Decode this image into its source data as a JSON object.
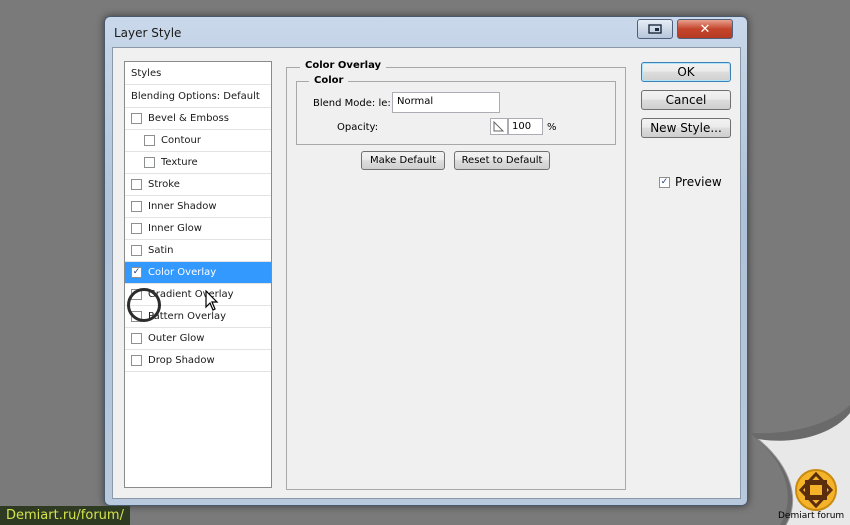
{
  "window": {
    "title": "Layer Style"
  },
  "styles_list": {
    "header": "Styles",
    "blending": "Blending Options: Default",
    "items": [
      {
        "label": "Bevel & Emboss",
        "checked": false,
        "indent": 1
      },
      {
        "label": "Contour",
        "checked": false,
        "indent": 2
      },
      {
        "label": "Texture",
        "checked": false,
        "indent": 2
      },
      {
        "label": "Stroke",
        "checked": false,
        "indent": 1
      },
      {
        "label": "Inner Shadow",
        "checked": false,
        "indent": 1
      },
      {
        "label": "Inner Glow",
        "checked": false,
        "indent": 1
      },
      {
        "label": "Satin",
        "checked": false,
        "indent": 1
      },
      {
        "label": "Color Overlay",
        "checked": true,
        "indent": 1,
        "selected": true
      },
      {
        "label": "Gradient Overlay",
        "checked": false,
        "indent": 1
      },
      {
        "label": "Pattern Overlay",
        "checked": false,
        "indent": 1
      },
      {
        "label": "Outer Glow",
        "checked": false,
        "indent": 1
      },
      {
        "label": "Drop Shadow",
        "checked": false,
        "indent": 1
      }
    ]
  },
  "panel": {
    "title": "Color Overlay",
    "subtitle": "Color",
    "blend_mode_label": "Blend Mode: le:",
    "blend_mode_value": "Normal",
    "opacity_label": "Opacity:",
    "opacity_value": "100",
    "opacity_unit": "%",
    "make_default": "Make Default",
    "reset_default": "Reset to Default"
  },
  "buttons": {
    "ok": "OK",
    "cancel": "Cancel",
    "new_style": "New Style...",
    "preview": "Preview",
    "preview_checked": true
  },
  "overlay": {
    "forum_url": "Demiart.ru/forum/",
    "forum_caption": "Demiart forum"
  },
  "colors": {
    "selection": "#3399ff",
    "titlebar": "#b9cbe0",
    "close": "#c4452c"
  }
}
